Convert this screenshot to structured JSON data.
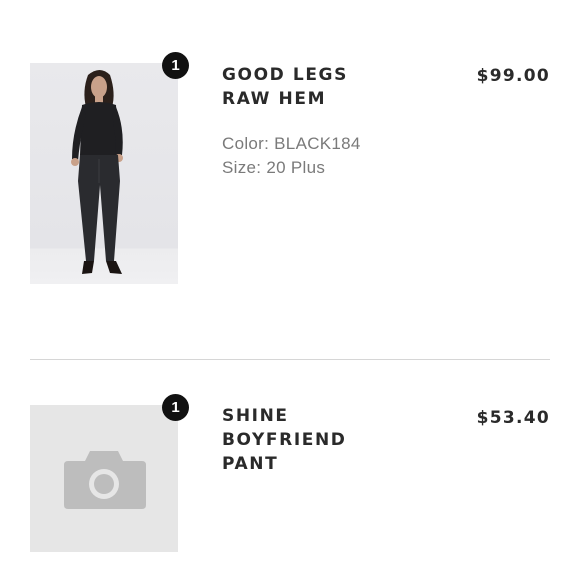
{
  "cart_items": [
    {
      "quantity": "1",
      "title_line1": "GOOD LEGS",
      "title_line2": "RAW HEM",
      "price": "$99.00",
      "color_label": "Color: BLACK184",
      "size_label": "Size: 20 Plus",
      "image": "product-photo-model-black-jeans"
    },
    {
      "quantity": "1",
      "title_line1": "SHINE",
      "title_line2": "BOYFRIEND",
      "title_line3": "PANT",
      "price": "$53.40",
      "image": "camera-placeholder-icon"
    }
  ],
  "colors": {
    "badge": "#111111",
    "placeholder": "#e6e6e6",
    "placeholder_icon": "#bdbdbd"
  }
}
